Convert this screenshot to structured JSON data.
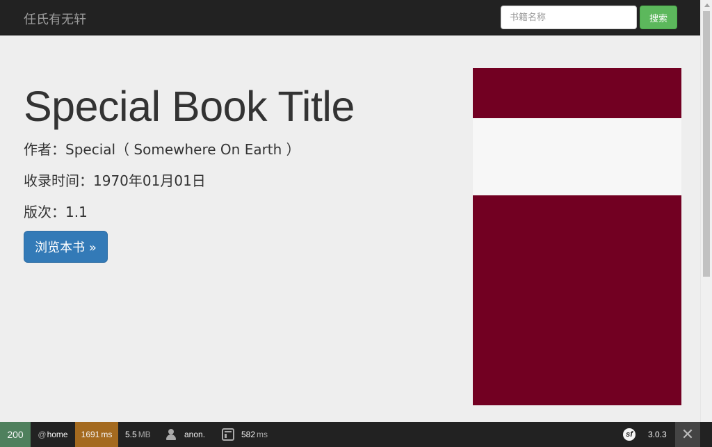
{
  "navbar": {
    "brand": "任氏有无轩",
    "search_placeholder": "书籍名称",
    "search_button": "搜索"
  },
  "book": {
    "title": "Special Book Title",
    "author_line": "作者：Special（ Somewhere On Earth ）",
    "date_line": "收录时间：1970年01月01日",
    "version_line": "版次：1.1",
    "read_button": "浏览本书 »",
    "cover_colors": {
      "background": "#720022",
      "band": "#f7f7f7"
    }
  },
  "debug_toolbar": {
    "status_code": "200",
    "route_prefix": "@",
    "route": "home",
    "time_value": "1691",
    "time_unit": "ms",
    "memory_value": "5.5",
    "memory_unit": "MB",
    "user": "anon.",
    "render_time_value": "582",
    "render_time_unit": "ms",
    "version": "3.0.3",
    "symfony_logo_text": "sf",
    "close_symbol": "✕",
    "colors": {
      "status": "#4f805d",
      "time": "#a46a1f",
      "background": "#222222"
    }
  },
  "icons": [
    "user-icon",
    "template-icon",
    "symfony-logo-icon",
    "close-icon",
    "scroll-up-arrow-icon"
  ]
}
